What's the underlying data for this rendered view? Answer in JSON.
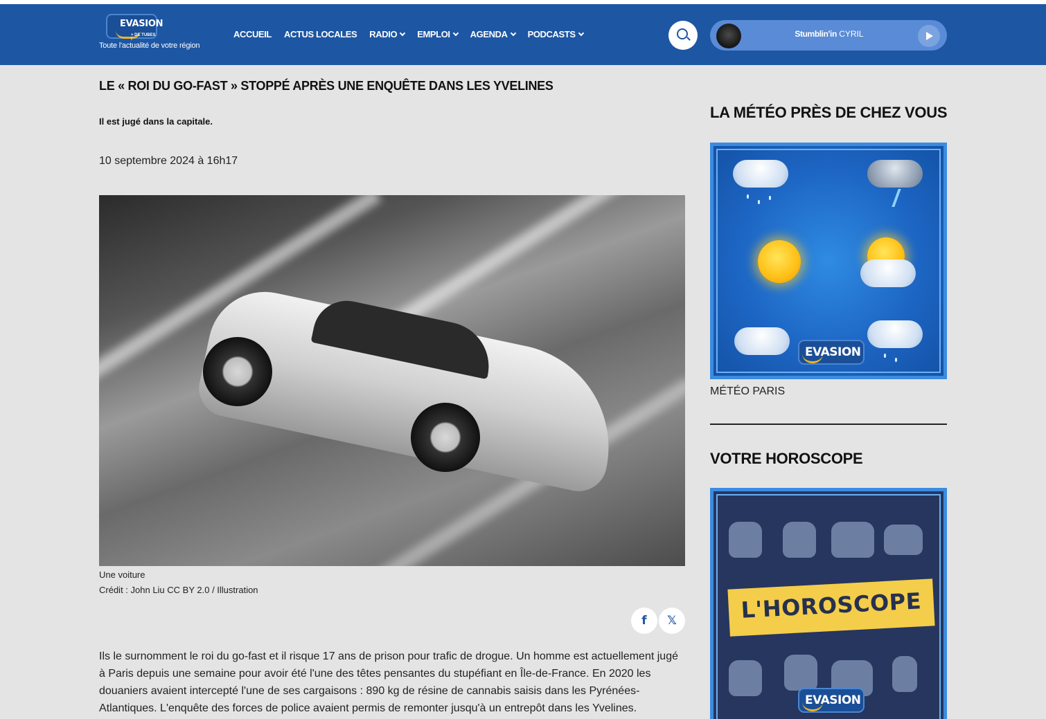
{
  "header": {
    "logo_text": "EVASION",
    "logo_sub": "+ DE TUBES !",
    "tagline": "Toute l'actualité de votre région",
    "nav": [
      {
        "label": "ACCUEIL",
        "has_dropdown": false
      },
      {
        "label": "ACTUS LOCALES",
        "has_dropdown": false
      },
      {
        "label": "RADIO",
        "has_dropdown": true
      },
      {
        "label": "EMPLOI",
        "has_dropdown": true
      },
      {
        "label": "AGENDA",
        "has_dropdown": true
      },
      {
        "label": "PODCASTS",
        "has_dropdown": true
      }
    ],
    "player": {
      "track": "Stumblin'in",
      "artist": "CYRIL"
    }
  },
  "article": {
    "title": "LE « ROI DU GO-FAST » STOPPÉ APRÈS UNE ENQUÊTE DANS LES YVELINES",
    "lead": "Il est jugé dans la capitale.",
    "date": "10 septembre 2024 à 16h17",
    "image_caption": "Une voiture",
    "image_credit": "Crédit : John Liu CC BY 2.0 / Illustration",
    "share": {
      "facebook": "f",
      "x": "𝕏"
    },
    "body": "Ils le surnomment le roi du go-fast et il risque 17 ans de prison pour trafic de drogue. Un homme est actuellement jugé à Paris depuis une semaine pour avoir été l'une des têtes pensantes du stupéfiant en Île-de-France. En 2020 les douaniers avaient intercepté l'une de ses cargaisons : 890 kg de résine de cannabis saisis dans les Pyrénées-Atlantiques. L'enquête des forces de police avaient permis de remonter jusqu'à un entrepôt dans les Yvelines."
  },
  "sidebar": {
    "weather_title": "LA MÉTÉO PRÈS DE CHEZ VOUS",
    "weather_badge": "EVASION",
    "weather_link": "MÉTÉO PARIS",
    "horoscope_title": "VOTRE HOROSCOPE",
    "horoscope_banner": "L'HOROSCOPE",
    "horoscope_badge": "EVASION"
  },
  "colors": {
    "header_bg": "#1d56a3",
    "page_bg": "#e4e4e4",
    "accent_yellow": "#f2b423"
  }
}
